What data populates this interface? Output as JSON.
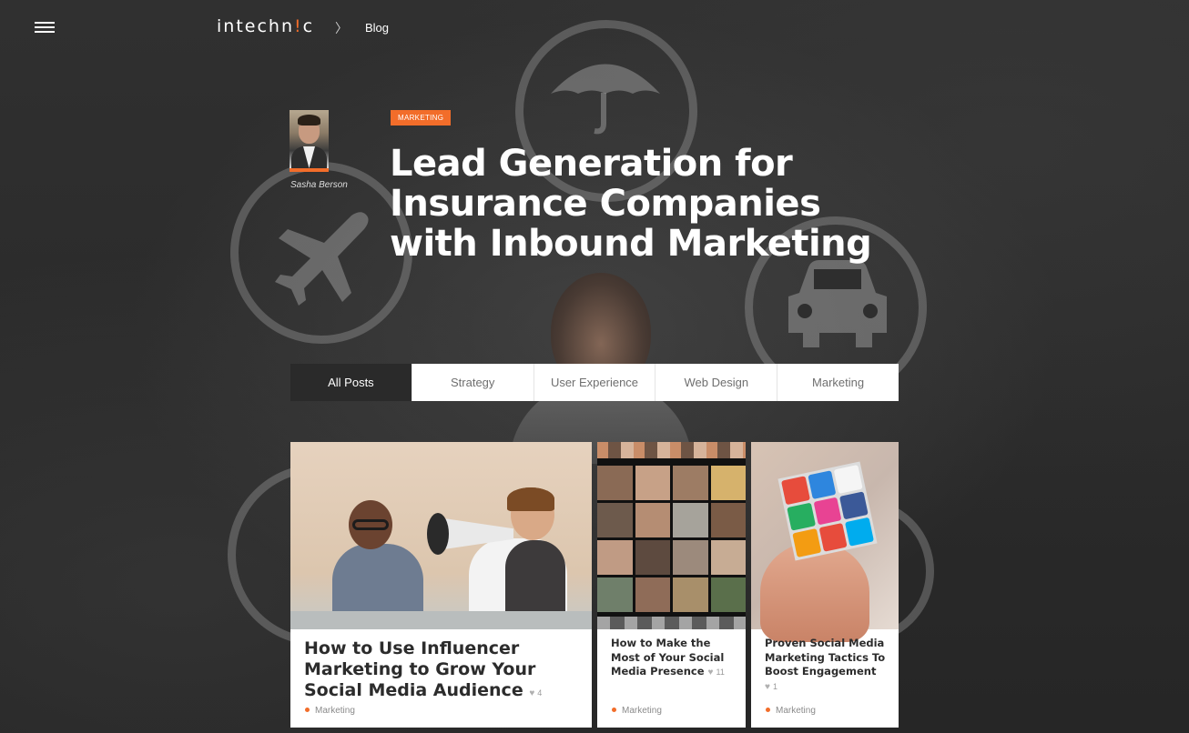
{
  "header": {
    "logo_prefix": "intechn",
    "logo_mark": "!",
    "logo_suffix": "c",
    "breadcrumb_separator": "〉",
    "breadcrumb": "Blog",
    "menu_icon": "hamburger-menu-icon"
  },
  "author": {
    "name": "Sasha Berson"
  },
  "article": {
    "category": "MARKETING",
    "title": "Lead Generation for Insurance Companies with Inbound Marketing"
  },
  "tabs": [
    {
      "label": "All Posts",
      "active": true
    },
    {
      "label": "Strategy",
      "active": false
    },
    {
      "label": "User Experience",
      "active": false
    },
    {
      "label": "Web Design",
      "active": false
    },
    {
      "label": "Marketing",
      "active": false
    }
  ],
  "cards": [
    {
      "title": "How to Use Influencer Marketing to Grow Your Social Media Audience",
      "likes": "4",
      "category": "Marketing"
    },
    {
      "title": "How to Make the Most of Your Social Media Presence",
      "likes": "11",
      "category": "Marketing"
    },
    {
      "title": "Proven Social Media Marketing Tactics To Boost Engagement",
      "likes": "1",
      "category": "Marketing"
    }
  ],
  "colors": {
    "accent": "#f26d2a",
    "background": "#2e2e2e",
    "tab_active": "#2a2a2a",
    "card_title": "#2c2c2c"
  }
}
